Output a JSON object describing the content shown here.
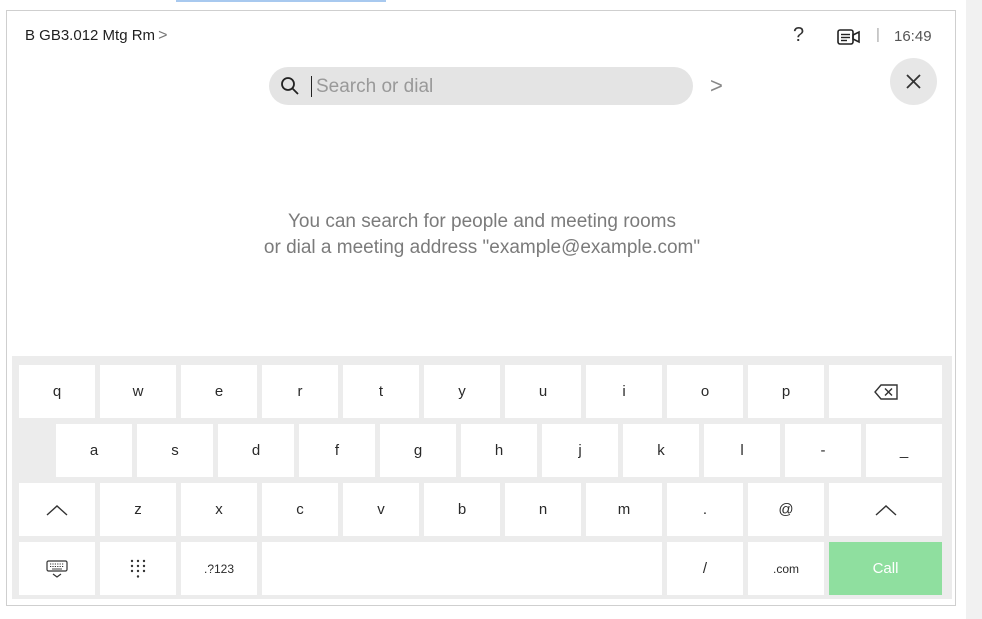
{
  "header": {
    "room_name": "B GB3.012 Mtg Rm",
    "room_chevron": ">",
    "help": "?",
    "separator": "|",
    "time": "16:49"
  },
  "search": {
    "placeholder": "Search or dial",
    "value": "",
    "go_chevron": ">"
  },
  "hint": {
    "line1": "You can search for people and meeting rooms",
    "line2": "or dial a meeting address \"example@example.com\""
  },
  "keyboard": {
    "row1": [
      "q",
      "w",
      "e",
      "r",
      "t",
      "y",
      "u",
      "i",
      "o",
      "p"
    ],
    "row2": [
      "a",
      "s",
      "d",
      "f",
      "g",
      "h",
      "j",
      "k",
      "l",
      "-",
      "_"
    ],
    "row3": [
      "z",
      "x",
      "c",
      "v",
      "b",
      "n",
      "m",
      ".",
      "@"
    ],
    "row4": {
      "numbers": ".?123",
      "slash": "/",
      "dotcom": ".com",
      "call": "Call"
    },
    "icons": {
      "backspace": "backspace-icon",
      "shift": "shift-icon",
      "hide_keyboard": "keyboard-hide-icon",
      "dialpad": "dialpad-icon"
    }
  },
  "colors": {
    "call_button": "#8fdf9f",
    "keyboard_bg": "#ececec",
    "search_bg": "#e4e4e4"
  }
}
